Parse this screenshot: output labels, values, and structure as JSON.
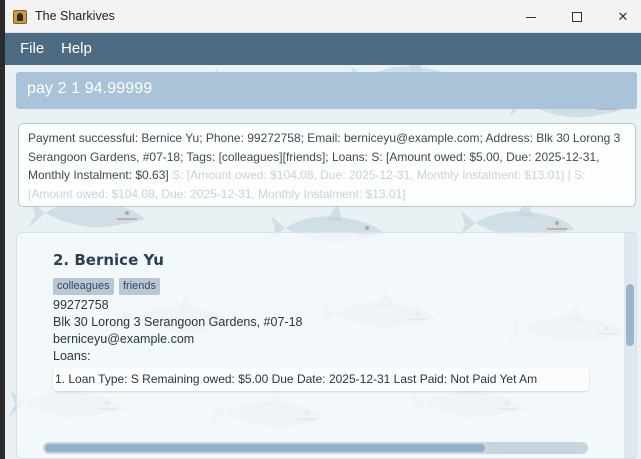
{
  "window": {
    "title": "The Sharkives",
    "minimize_glyph": "─",
    "maximize_glyph": "☐",
    "close_glyph": "✕",
    "icon": "shark-app-icon"
  },
  "menu": {
    "items": [
      {
        "label": "File"
      },
      {
        "label": "Help"
      }
    ]
  },
  "command": {
    "value": "pay 2 1 94.99999"
  },
  "result": {
    "text": "Payment successful: Bernice Yu; Phone: 99272758; Email: berniceyu@example.com; Address: Blk 30 Lorong 3 Serangoon Gardens, #07-18; Tags: [colleagues][friends]; Loans: S: [Amount owed: $5.00, Due: 2025-12-31, Monthly Instalment: $0.63]",
    "faded": " S: [Amount owed: $104.08, Due: 2025-12-31, Monthly Instalment: $13.01] | S: [Amount owed: $104.08, Due: 2025-12-31, Monthly Instalment: $13.01]"
  },
  "person": {
    "index_name": "2.  Bernice Yu",
    "tags": [
      "colleagues",
      "friends"
    ],
    "phone": "99272758",
    "address": "Blk 30 Lorong 3 Serangoon Gardens, #07-18",
    "email": "berniceyu@example.com",
    "loans_label": "Loans:",
    "loan_row": "1. Loan Type: S    Remaining owed: $5.00    Due Date: 2025-12-31    Last Paid: Not Paid Yet    Am"
  },
  "colors": {
    "menubar": "#4d6a83",
    "command_box": "#a9c3d8",
    "name": "#2d3f55",
    "tag": "#b8c7d3"
  }
}
